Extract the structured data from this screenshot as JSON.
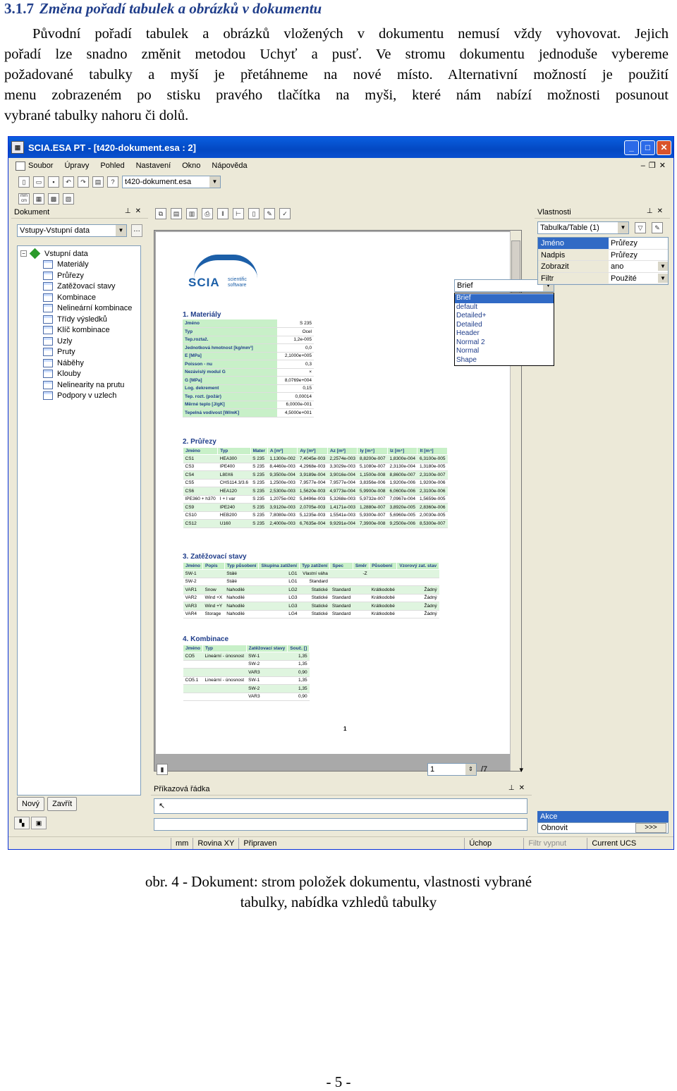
{
  "heading": {
    "number": "3.1.7",
    "title": "Změna pořadí tabulek a obrázků v dokumentu"
  },
  "paragraph": [
    "Původní pořadí tabulek a obrázků vložených v dokumentu nemusí vždy vyhovovat. Jejich",
    "pořadí lze snadno změnit metodou Uchyť a pusť. Ve stromu dokumentu jednoduše vybereme",
    "požadované tabulky a myší je přetáhneme na nové místo. Alternativní možností je použití",
    "menu zobrazeném po stisku pravého tlačítka na myši, které nám nabízí možnosti posunout",
    "vybrané tabulky nahoru či dolů."
  ],
  "window": {
    "title": "SCIA.ESA PT - [t420-dokument.esa : 2]",
    "menu": [
      "Soubor",
      "Úpravy",
      "Pohled",
      "Nastavení",
      "Okno",
      "Nápověda"
    ],
    "file_combo": "t420-dokument.esa",
    "toolbar2_label": "mm cm"
  },
  "left_panel": {
    "title": "Dokument",
    "combo": "Vstupy-Vstupní data",
    "tree_root": "Vstupní data",
    "tree_items": [
      "Materiály",
      "Průřezy",
      "Zatěžovací stavy",
      "Kombinace",
      "Nelineární kombinace",
      "Třídy výsledků",
      "Klíč kombinace",
      "Uzly",
      "Pruty",
      "Náběhy",
      "Klouby",
      "Nelinearity na prutu",
      "Podpory v uzlech"
    ],
    "btn_new": "Nový",
    "btn_close": "Zavřít"
  },
  "doc_view": {
    "style_combo": "Brief",
    "style_options": [
      "Brief",
      "default",
      "Detailed+",
      "Detailed",
      "Header",
      "Normal 2",
      "Normal",
      "Shape"
    ],
    "logo_text": "SCIA",
    "logo_sub": "scientific software",
    "page_input": "1",
    "page_total": "/7",
    "page_number": "1"
  },
  "report": {
    "s1_title": "1. Materiály",
    "materials": [
      [
        "Jméno",
        "S 235"
      ],
      [
        "Typ",
        "Ocel"
      ],
      [
        "Tep.roztaž.",
        "1,2e-005"
      ],
      [
        "Jednotková hmotnost [kg/mm³]",
        "0,0"
      ],
      [
        "E [MPa]",
        "2,1000e+005"
      ],
      [
        "Poisson - nu",
        "0,3"
      ],
      [
        "Nezávislý modul G",
        "×"
      ],
      [
        "G [MPa]",
        "8,0769e+004"
      ],
      [
        "Log. dekrement",
        "0,15"
      ],
      [
        "Tep. rozt. (požár)",
        "0,00014"
      ],
      [
        "Měrné teplo [J/gK]",
        "6,0000e-001"
      ],
      [
        "Tepelná vodivost [W/mK]",
        "4,5000e+001"
      ]
    ],
    "s2_title": "2. Průřezy",
    "sections_header": [
      "Jméno",
      "Typ",
      "Mater",
      "A [m²]",
      "Ay [m²]",
      "Az [m²]",
      "Iy [m⁴]",
      "Iz [m⁴]",
      "It [m⁴]"
    ],
    "sections": [
      [
        "CS1",
        "HEA300",
        "S 235",
        "1,1300e-002",
        "7,4045e-003",
        "2,2574e-003",
        "8,8200e-007",
        "1,8300e-004",
        "6,3100e-005"
      ],
      [
        "CS3",
        "IPE400",
        "S 235",
        "8,4460e-003",
        "4,2968e-003",
        "3,3029e-003",
        "5,1080e-007",
        "2,3130e-004",
        "1,3180e-005"
      ],
      [
        "CS4",
        "L80X6",
        "S 235",
        "9,3500e-004",
        "3,9189e-004",
        "3,9016e-004",
        "1,1500e-008",
        "8,8600e-007",
        "2,3100e-007"
      ],
      [
        "CS5",
        "CHS114.3/3.6",
        "S 235",
        "1,2500e-003",
        "7,9577e-004",
        "7,9577e-004",
        "3,8356e-006",
        "1,9200e-006",
        "1,9200e-006"
      ],
      [
        "CS6",
        "HEA120",
        "S 235",
        "2,5300e-003",
        "1,5620e-003",
        "4,9773e-004",
        "5,9900e-008",
        "6,0600e-006",
        "2,3100e-006"
      ],
      [
        "IPE360 + h370",
        "I + I var",
        "S 235",
        "1,2075e-002",
        "5,8496e-003",
        "5,3268e-003",
        "5,9732e-007",
        "7,0967e-004",
        "1,5659e-005"
      ],
      [
        "CS9",
        "IPE240",
        "S 235",
        "3,9120e-003",
        "2,0705e-003",
        "1,4171e-003",
        "1,2880e-007",
        "3,8920e-005",
        "2,8360e-006"
      ],
      [
        "CS10",
        "HEB200",
        "S 235",
        "7,8080e-003",
        "5,1235e-003",
        "1,5541e-003",
        "5,9300e-007",
        "5,6960e-005",
        "2,0030e-005"
      ],
      [
        "CS12",
        "U160",
        "S 235",
        "2,4000e-003",
        "6,7635e-004",
        "9,9291e-004",
        "7,3900e-008",
        "9,2500e-006",
        "8,5300e-007"
      ]
    ],
    "s3_title": "3. Zatěžovací stavy",
    "lc_header": [
      "Jméno",
      "Popis",
      "Typ působení",
      "Skupina zatížení",
      "Typ zatížení",
      "Spec",
      "Směr",
      "Působení",
      "Vzorový zat. stav"
    ],
    "load_cases": [
      [
        "SW-1",
        "",
        "Stálé",
        "LG1",
        "Vlastní váha",
        "",
        "-Z",
        "",
        ""
      ],
      [
        "SW-2",
        "",
        "Stálé",
        "LG1",
        "Standard",
        "",
        "",
        "",
        ""
      ],
      [
        "VAR1",
        "Snow",
        "Nahodilé",
        "LG2",
        "Statické",
        "Standard",
        "",
        "Krátkodobé",
        "Žádný"
      ],
      [
        "VAR2",
        "Wind +X",
        "Nahodilé",
        "LG3",
        "Statické",
        "Standard",
        "",
        "Krátkodobé",
        "Žádný"
      ],
      [
        "VAR3",
        "Wind +Y",
        "Nahodilé",
        "LG3",
        "Statické",
        "Standard",
        "",
        "Krátkodobé",
        "Žádný"
      ],
      [
        "VAR4",
        "Storage",
        "Nahodilé",
        "LG4",
        "Statické",
        "Standard",
        "",
        "Krátkodobé",
        "Žádný"
      ]
    ],
    "s4_title": "4. Kombinace",
    "comb_header": [
      "Jméno",
      "Typ",
      "Zatěžovací stavy",
      "Souč. []"
    ],
    "combinations": [
      [
        "CO5",
        "Lineární - únosnost",
        "SW-1",
        "1,35"
      ],
      [
        "",
        "",
        "SW-2",
        "1,35"
      ],
      [
        "",
        "",
        "VAR3",
        "0,90"
      ],
      [
        "CO5.1",
        "Lineární - únosnost",
        "SW-1",
        "1,35"
      ],
      [
        "",
        "",
        "SW-2",
        "1,35"
      ],
      [
        "",
        "",
        "VAR3",
        "0,90"
      ]
    ]
  },
  "command": {
    "title": "Příkazová řádka"
  },
  "right_panel": {
    "title": "Vlastnosti",
    "combo": "Tabulka/Table (1)",
    "props": [
      [
        "Jméno",
        "Průřezy"
      ],
      [
        "Nadpis",
        "Průřezy"
      ],
      [
        "Zobrazit",
        "ano"
      ],
      [
        "Filtr",
        "Použité"
      ]
    ],
    "akce": "Akce",
    "obnovit": "Obnovit",
    "more": ">>>"
  },
  "status": [
    "mm",
    "Rovina XY",
    "Připraven",
    "Úchop",
    "Filtr vypnut",
    "Current UCS"
  ],
  "caption": [
    "obr. 4 - Dokument: strom položek dokumentu, vlastnosti vybrané",
    "tabulky, nabídka vzhledů tabulky"
  ],
  "page_footer": "- 5 -"
}
